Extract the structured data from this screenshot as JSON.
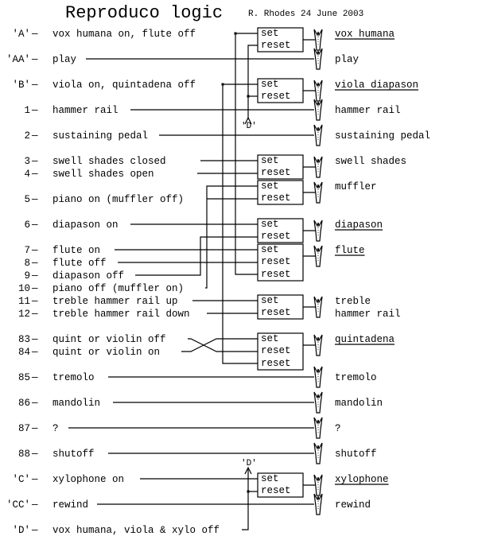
{
  "header": {
    "title": "Reproduco logic",
    "author_date": "R. Rhodes 24 June 2003"
  },
  "dash": "—",
  "inputs": [
    {
      "code": "'A'",
      "label": "vox humana on, flute off"
    },
    {
      "code": "'AA'",
      "label": "play"
    },
    {
      "code": "'B'",
      "label": "viola on, quintadena off"
    },
    {
      "code": "1",
      "label": "hammer rail"
    },
    {
      "code": "2",
      "label": "sustaining pedal"
    },
    {
      "code": "3",
      "label": "swell shades closed"
    },
    {
      "code": "4",
      "label": "swell shades open"
    },
    {
      "code": "5",
      "label": "piano on (muffler off)"
    },
    {
      "code": "6",
      "label": "diapason on"
    },
    {
      "code": "7",
      "label": "flute on"
    },
    {
      "code": "8",
      "label": "flute off"
    },
    {
      "code": "9",
      "label": "diapason off"
    },
    {
      "code": "10",
      "label": "piano off (muffler on)"
    },
    {
      "code": "11",
      "label": "treble hammer rail up"
    },
    {
      "code": "12",
      "label": "treble hammer rail down"
    },
    {
      "code": "83",
      "label": "quint or violin off"
    },
    {
      "code": "84",
      "label": "quint or violin on"
    },
    {
      "code": "85",
      "label": "tremolo"
    },
    {
      "code": "86",
      "label": "mandolin"
    },
    {
      "code": "87",
      "label": "?"
    },
    {
      "code": "88",
      "label": "shutoff"
    },
    {
      "code": "'C'",
      "label": "xylophone on"
    },
    {
      "code": "'CC'",
      "label": "rewind"
    },
    {
      "code": "'D'",
      "label": "vox humana, viola & xylo off"
    }
  ],
  "latches": [
    {
      "id": "vox",
      "ports": [
        "set",
        "reset"
      ]
    },
    {
      "id": "viola",
      "ports": [
        "set",
        "reset"
      ]
    },
    {
      "id": "swell",
      "ports": [
        "set",
        "reset"
      ]
    },
    {
      "id": "muffler",
      "ports": [
        "set",
        "reset"
      ]
    },
    {
      "id": "diapason",
      "ports": [
        "set",
        "reset"
      ]
    },
    {
      "id": "flute",
      "ports": [
        "set",
        "reset",
        "reset"
      ]
    },
    {
      "id": "treble",
      "ports": [
        "set",
        "reset"
      ]
    },
    {
      "id": "quint",
      "ports": [
        "set",
        "reset",
        "reset"
      ]
    },
    {
      "id": "xylo",
      "ports": [
        "set",
        "reset"
      ]
    }
  ],
  "outputs": [
    {
      "label": "vox humana",
      "latched": true
    },
    {
      "label": "play",
      "latched": false
    },
    {
      "label": "viola diapason",
      "latched": true
    },
    {
      "label": "hammer rail",
      "latched": false
    },
    {
      "label": "sustaining pedal",
      "latched": false
    },
    {
      "label": "swell shades",
      "latched": false
    },
    {
      "label": "muffler",
      "latched": false
    },
    {
      "label": "diapason",
      "latched": true
    },
    {
      "label": "flute",
      "latched": true
    },
    {
      "label": "treble",
      "latched": false
    },
    {
      "label": "hammer rail",
      "latched": false
    },
    {
      "label": "quintadena",
      "latched": true
    },
    {
      "label": "tremolo",
      "latched": false
    },
    {
      "label": "mandolin",
      "latched": false
    },
    {
      "label": "?",
      "latched": false
    },
    {
      "label": "shutoff",
      "latched": false
    },
    {
      "label": "xylophone",
      "latched": true
    },
    {
      "label": "rewind",
      "latched": false
    }
  ],
  "bus_labels": {
    "d_upper": "'D'",
    "d_lower": "'D'"
  }
}
